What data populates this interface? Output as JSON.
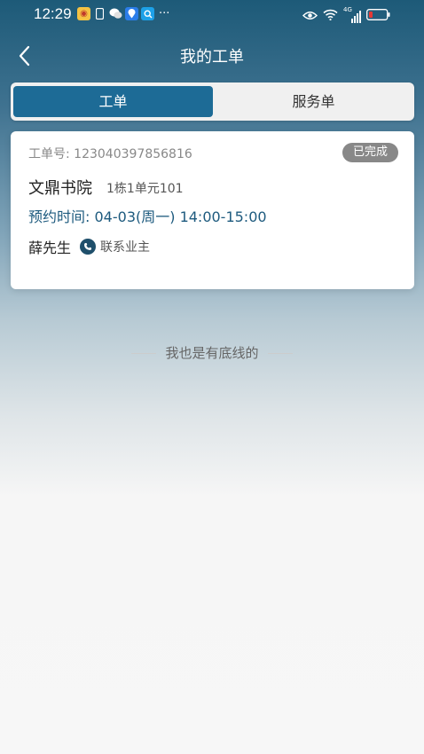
{
  "status_bar": {
    "time": "12:29",
    "left_icons": [
      "weibo-icon",
      "phone-icon",
      "wechat-icon",
      "location-icon",
      "search-app-icon",
      "more-dots-icon"
    ],
    "right_icons": [
      "eye-icon",
      "wifi-icon",
      "signal-icon",
      "battery-icon"
    ],
    "network_label": "4G",
    "more": "···"
  },
  "nav": {
    "title": "我的工单",
    "back_icon": "chevron-left-icon"
  },
  "tabs": [
    {
      "label": "工单",
      "active": true
    },
    {
      "label": "服务单",
      "active": false
    }
  ],
  "order": {
    "number_label": "工单号:",
    "number": "123040397856816",
    "status": "已完成",
    "place": "文鼎书院",
    "unit": "1栋1单元101",
    "appointment_label": "预约时间:",
    "appointment_time": "04-03(周一) 14:00-15:00",
    "person": "薛先生",
    "contact_label": "联系业主"
  },
  "footer": {
    "end_text": "我也是有底线的"
  },
  "colors": {
    "accent": "#1d6b96",
    "appointment_text": "#1d5a7e",
    "status_badge": "#888888"
  }
}
